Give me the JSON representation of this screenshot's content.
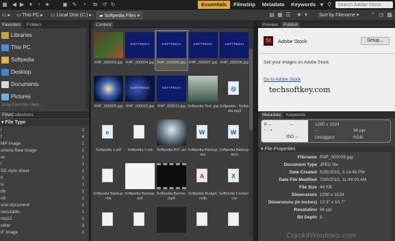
{
  "toolbar": {
    "workspaces": [
      "Essentials",
      "Filmstrip",
      "Metadata",
      "Keywords"
    ],
    "search_placeholder": "Search Adobe Stock"
  },
  "path": {
    "this_pc": "This PC",
    "local_disk": "Local Disk (C:)",
    "folder": "Softpedia Files",
    "sort": "Sort by Filename"
  },
  "left_panel": {
    "tabs": [
      "Favorites",
      "Folders"
    ],
    "favorites": [
      {
        "label": "Libraries",
        "icon": "libraries-icon"
      },
      {
        "label": "This PC",
        "icon": "computer-icon"
      },
      {
        "label": "Softpedia",
        "icon": "folder-icon"
      },
      {
        "label": "Desktop",
        "icon": "desktop-icon"
      },
      {
        "label": "Documents",
        "icon": "documents-icon"
      },
      {
        "label": "Pictures",
        "icon": "pictures-icon"
      }
    ],
    "drag_hint": "Drag Favorites Here..."
  },
  "filter_panel": {
    "tabs": [
      "Filter",
      "Collections"
    ],
    "heading": "File Type",
    "rows": [
      {
        "label": "r",
        "count": "1"
      },
      {
        "label": "f",
        "count": "4"
      },
      {
        "label": "MP image",
        "count": "1"
      },
      {
        "label": "amera Raw image",
        "count": "1"
      },
      {
        "label": "oc",
        "count": "1"
      },
      {
        "label": "l",
        "count": "1"
      },
      {
        "label": "SS style sheet",
        "count": "1"
      },
      {
        "label": "ll",
        "count": "1"
      },
      {
        "label": "lx",
        "count": "1"
      },
      {
        "label": "db",
        "count": "1"
      },
      {
        "label": "ub",
        "count": "1"
      },
      {
        "label": "xcel document",
        "count": "1"
      },
      {
        "label": "xecutable",
        "count": "1"
      },
      {
        "label": "mp12",
        "count": "1"
      },
      {
        "label": "older",
        "count": "3"
      },
      {
        "label": "IF image",
        "count": "1"
      }
    ]
  },
  "content": {
    "tab": "Content",
    "items": [
      {
        "caption": "R4P_000003.jpg",
        "kind": "nature"
      },
      {
        "caption": "R4P_000004.jpg",
        "kind": "softpedia"
      },
      {
        "caption": "R4P_000006.jpg",
        "kind": "softpedia",
        "selected": true
      },
      {
        "caption": "R4P_000007.jpg",
        "kind": "softpedia"
      },
      {
        "caption": "R4P_000008.jpg",
        "kind": "softpedia"
      },
      {
        "caption": "R4P_000009.jpg",
        "kind": "swirl"
      },
      {
        "caption": "R4P_000010.jpg",
        "kind": "softpedia2"
      },
      {
        "caption": "R4P_000011.jpg",
        "kind": "softpedia"
      },
      {
        "caption": "Softpedia Test .jpg",
        "kind": "forest"
      },
      {
        "caption": "Softpedia - Softpedia.mp3",
        "kind": "audio-icon"
      },
      {
        "caption": "Softpedia 1.pdf",
        "kind": "pdf-icon"
      },
      {
        "caption": "Softpedia 2.ost",
        "kind": "ost-icon"
      },
      {
        "caption": "Softpedia AVI .avi",
        "kind": "avi"
      },
      {
        "caption": "Softpedia Backup.doc",
        "kind": "word-icon"
      },
      {
        "caption": "Softpedia Backup.docx",
        "kind": "word-icon"
      },
      {
        "caption": "Softpedia Backup.nbk",
        "kind": "blank-icon"
      },
      {
        "caption": "Softpedia Backup.pdf",
        "kind": "pdfpage"
      },
      {
        "caption": "Softpedia Banner.mp4",
        "kind": "video"
      },
      {
        "caption": "Softpedia Budget.mdb",
        "kind": "access-icon"
      },
      {
        "caption": "Softpedia Contact.csv",
        "kind": "excel-icon"
      },
      {
        "caption": "",
        "kind": "blank-icon"
      },
      {
        "caption": "",
        "kind": "blank-icon"
      },
      {
        "caption": "",
        "kind": "dark"
      },
      {
        "caption": "",
        "kind": "blank-icon"
      },
      {
        "caption": "",
        "kind": "blank-icon"
      }
    ]
  },
  "right_panel": {
    "tabs": [
      "Preview",
      "Publish"
    ],
    "stock_title": "Adobe Stock",
    "setup_label": "Setup...",
    "sell_text": "Sell your images on Adobe Stock",
    "stock_link": "Go to Adobe Stock",
    "overlay_text": "techsoftkey.com"
  },
  "metadata": {
    "tabs": [
      "Metadata",
      "Keywords"
    ],
    "camera": {
      "fstop": "f/ --",
      "shutter": "--",
      "iso": "ISO --"
    },
    "summary": {
      "dimensions": "1280 x 1024",
      "ppi": "96 ppi",
      "tagged": "Untagged",
      "mode": "RGB"
    },
    "section": "File Properties",
    "properties": [
      {
        "key": "Filename",
        "value": "R4P_000006.jpg"
      },
      {
        "key": "Document Type",
        "value": "JPEG file"
      },
      {
        "key": "Date Created",
        "value": "5/25/2015, 3:14:48 PM"
      },
      {
        "key": "Date File Modified",
        "value": "7/30/2015, 11:49:03 AM"
      },
      {
        "key": "File Size",
        "value": "44 KB"
      },
      {
        "key": "Dimensions",
        "value": "1280 x 1024"
      },
      {
        "key": "Dimensions (in inches)",
        "value": "13.3\" x 10.7\""
      },
      {
        "key": "Resolution",
        "value": "96 ppi"
      },
      {
        "key": "Bit Depth",
        "value": "8"
      }
    ]
  },
  "watermark": "Crack4Windows.com",
  "colors": {
    "accent": "#e7a92f",
    "panel": "#3e3e3e",
    "dark": "#1e1e1e"
  }
}
